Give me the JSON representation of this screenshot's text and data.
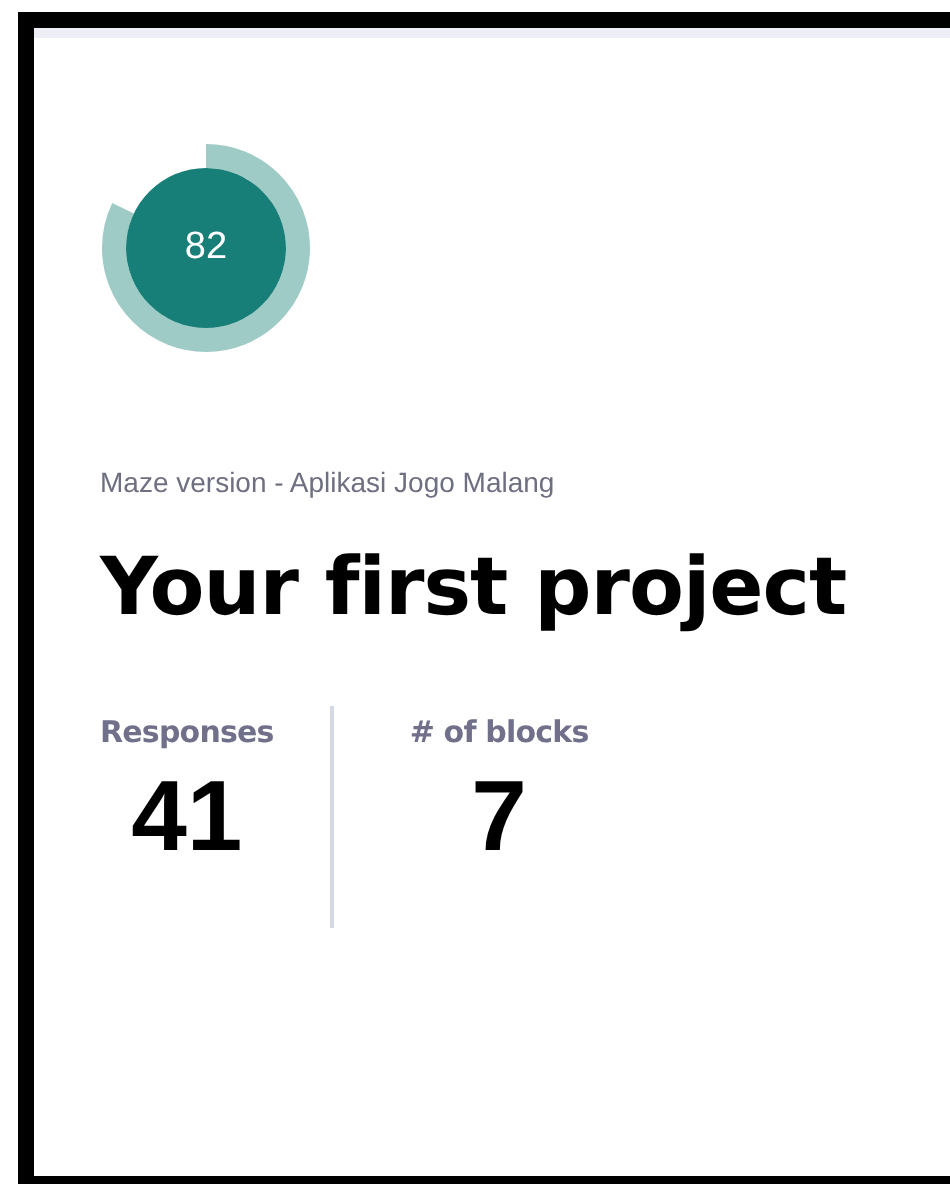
{
  "score": {
    "value": "82",
    "level": 0.82
  },
  "subtitle": "Maze version - Aplikasi Jogo Malang",
  "title": "Your first project",
  "stats": [
    {
      "label": "Responses",
      "value": "41"
    },
    {
      "label": "# of blocks",
      "value": "7"
    }
  ]
}
